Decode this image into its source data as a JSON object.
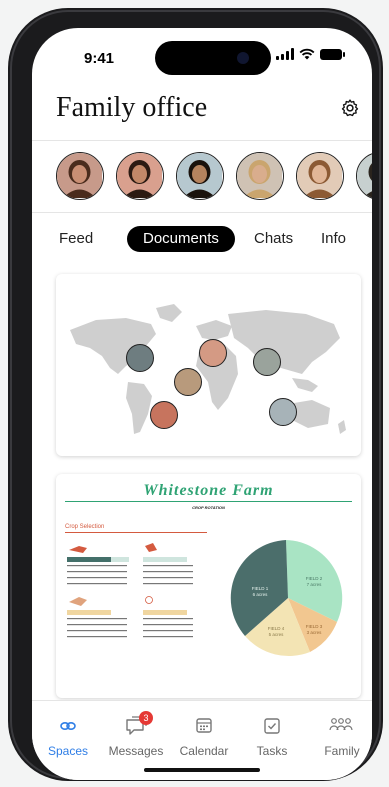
{
  "status_bar": {
    "time": "9:41"
  },
  "header": {
    "title": "Family office",
    "settings_icon": "gear-icon"
  },
  "members": [
    {
      "name": "avatar-1",
      "bg": "#c79a8a",
      "skin": "#c98f74",
      "hair": "#4a2c1d"
    },
    {
      "name": "avatar-2",
      "bg": "#d9a08e",
      "skin": "#c38868",
      "hair": "#2b1a12"
    },
    {
      "name": "avatar-3",
      "bg": "#b6c8cf",
      "skin": "#b5835e",
      "hair": "#1a120c"
    },
    {
      "name": "avatar-4",
      "bg": "#cfc2b4",
      "skin": "#d9ad8d",
      "hair": "#caa56e"
    },
    {
      "name": "avatar-5",
      "bg": "#e2cbb7",
      "skin": "#e1b697",
      "hair": "#8c5a34"
    },
    {
      "name": "avatar-6",
      "bg": "#c7d0cf",
      "skin": "#b88563",
      "hair": "#2a241d"
    }
  ],
  "tabs": [
    {
      "label": "Feed",
      "active": false
    },
    {
      "label": "Documents",
      "active": true
    },
    {
      "label": "Chats",
      "active": false
    },
    {
      "label": "Info",
      "active": false
    }
  ],
  "document": {
    "title": "Whitestone Farm",
    "subtitle": "CROP ROTATION",
    "section": "Crop Selection",
    "pie_labels": [
      {
        "field": "FIELD 1",
        "acres": "6 acres"
      },
      {
        "field": "FIELD 2",
        "acres": "7 acres"
      },
      {
        "field": "FIELD 3",
        "acres": "3 acres"
      },
      {
        "field": "FIELD 4",
        "acres": "5 acres"
      }
    ]
  },
  "bottom_nav": [
    {
      "label": "Spaces",
      "icon": "spaces-icon",
      "active": true,
      "badge": ""
    },
    {
      "label": "Messages",
      "icon": "messages-icon",
      "active": false,
      "badge": "3"
    },
    {
      "label": "Calendar",
      "icon": "calendar-icon",
      "active": false,
      "badge": ""
    },
    {
      "label": "Tasks",
      "icon": "tasks-icon",
      "active": false,
      "badge": ""
    },
    {
      "label": "Family",
      "icon": "family-icon",
      "active": false,
      "badge": ""
    }
  ],
  "colors": {
    "accent": "#2f7ee6",
    "badge": "#e53935",
    "farm_green": "#2fa374",
    "map": "#cfcfcf"
  }
}
